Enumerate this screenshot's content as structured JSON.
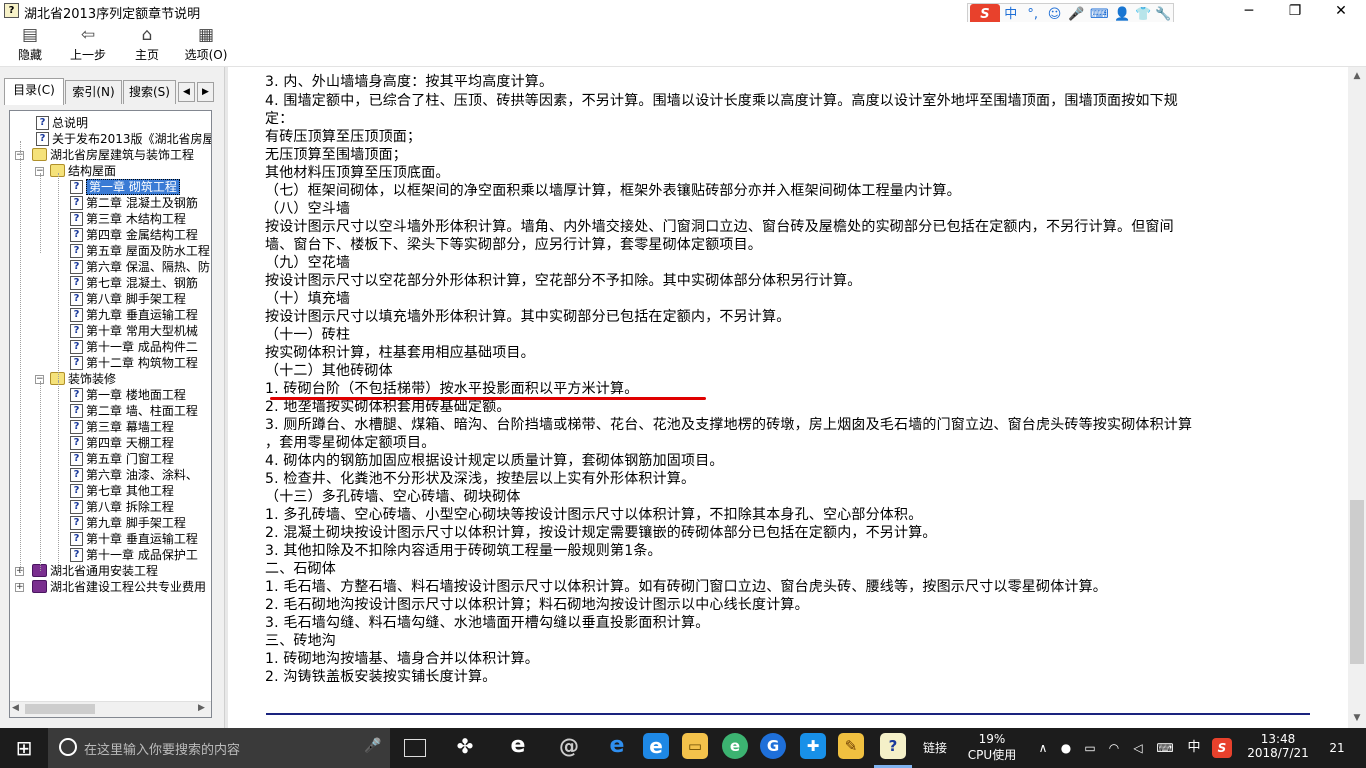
{
  "window": {
    "title": "湖北省2013序列定额章节说明",
    "app_icon_glyph": "?",
    "minimize": "─",
    "maximize": "❐",
    "close": "✕"
  },
  "ime": {
    "logo": "S",
    "mode": "中",
    "punct": "°,",
    "emoji": "☺",
    "voice": "🎤",
    "keyboard": "⌨",
    "user": "👤",
    "skin": "👕",
    "settings": "🔧"
  },
  "toolbar": {
    "hide": "隐藏",
    "back": "上一步",
    "home": "主页",
    "options": "选项(O)"
  },
  "tabs": {
    "contents": "目录(C)",
    "index": "索引(N)",
    "search": "搜索(S)",
    "prev": "◀",
    "next": "▶"
  },
  "tree": [
    {
      "label": "总说明",
      "icon": "help-page"
    },
    {
      "label": "关于发布2013版《湖北省房屋",
      "icon": "help-page"
    },
    {
      "label": "湖北省房屋建筑与装饰工程",
      "icon": "book-open"
    },
    {
      "label": "结构屋面",
      "icon": "book-open"
    },
    {
      "label": "第一章  砌筑工程",
      "icon": "help-page",
      "selected": true
    },
    {
      "label": "第二章  混凝土及钢筋",
      "icon": "help-page"
    },
    {
      "label": "第三章  木结构工程",
      "icon": "help-page"
    },
    {
      "label": "第四章  金属结构工程",
      "icon": "help-page"
    },
    {
      "label": "第五章  屋面及防水工程",
      "icon": "help-page"
    },
    {
      "label": "第六章  保温、隔热、防",
      "icon": "help-page"
    },
    {
      "label": "第七章  混凝土、钢筋",
      "icon": "help-page"
    },
    {
      "label": "第八章  脚手架工程",
      "icon": "help-page"
    },
    {
      "label": "第九章  垂直运输工程",
      "icon": "help-page"
    },
    {
      "label": "第十章  常用大型机械",
      "icon": "help-page"
    },
    {
      "label": "第十一章  成品构件二",
      "icon": "help-page"
    },
    {
      "label": "第十二章  构筑物工程",
      "icon": "help-page"
    },
    {
      "label": "装饰装修",
      "icon": "book-open"
    },
    {
      "label": "第一章  楼地面工程",
      "icon": "help-page"
    },
    {
      "label": "第二章  墙、柱面工程",
      "icon": "help-page"
    },
    {
      "label": "第三章  幕墙工程",
      "icon": "help-page"
    },
    {
      "label": "第四章  天棚工程",
      "icon": "help-page"
    },
    {
      "label": "第五章  门窗工程",
      "icon": "help-page"
    },
    {
      "label": "第六章  油漆、涂料、",
      "icon": "help-page"
    },
    {
      "label": "第七章  其他工程",
      "icon": "help-page"
    },
    {
      "label": "第八章  拆除工程",
      "icon": "help-page"
    },
    {
      "label": "第九章  脚手架工程",
      "icon": "help-page"
    },
    {
      "label": "第十章  垂直运输工程",
      "icon": "help-page"
    },
    {
      "label": "第十一章  成品保护工",
      "icon": "help-page"
    },
    {
      "label": "湖北省通用安装工程",
      "icon": "book-closed"
    },
    {
      "label": "湖北省建设工程公共专业费用",
      "icon": "book-closed"
    }
  ],
  "content": {
    "lines": [
      "3. 内、外山墙墙身高度：按其平均高度计算。",
      "4. 围墙定额中，已综合了柱、压顶、砖拱等因素，不另计算。围墙以设计长度乘以高度计算。高度以设计室外地坪至围墙顶面，围墙顶面按如下规",
      "定：",
      "有砖压顶算至压顶顶面；",
      "无压顶算至围墙顶面；",
      "其他材料压顶算至压顶底面。",
      "（七）框架间砌体，以框架间的净空面积乘以墙厚计算，框架外表镶贴砖部分亦并入框架间砌体工程量内计算。",
      "（八）空斗墙",
      "按设计图示尺寸以空斗墙外形体积计算。墙角、内外墙交接处、门窗洞口立边、窗台砖及屋檐处的实砌部分已包括在定额内，不另行计算。但窗间",
      "墙、窗台下、楼板下、梁头下等实砌部分，应另行计算，套零星砌体定额项目。",
      "（九）空花墙",
      "按设计图示尺寸以空花部分外形体积计算，空花部分不予扣除。其中实砌体部分体积另行计算。",
      "（十）填充墙",
      "按设计图示尺寸以填充墙外形体积计算。其中实砌部分已包括在定额内，不另计算。",
      "（十一）砖柱",
      "按实砌体积计算，柱基套用相应基础项目。",
      "（十二）其他砖砌体",
      "1. 砖砌台阶（不包括梯带）按水平投影面积以平方米计算。",
      "2. 地垄墙按实砌体积套用砖基础定额。",
      "3. 厕所蹲台、水槽腿、煤箱、暗沟、台阶挡墙或梯带、花台、花池及支撑地楞的砖墩，房上烟囱及毛石墙的门窗立边、窗台虎头砖等按实砌体积计算",
      "，套用零星砌体定额项目。",
      "4. 砌体内的钢筋加固应根据设计规定以质量计算，套砌体钢筋加固项目。",
      "5. 检查井、化粪池不分形状及深浅，按垫层以上实有外形体积计算。",
      "（十三）多孔砖墙、空心砖墙、砌块砌体",
      "1. 多孔砖墙、空心砖墙、小型空心砌块等按设计图示尺寸以体积计算，不扣除其本身孔、空心部分体积。",
      "2. 混凝土砌块按设计图示尺寸以体积计算，按设计规定需要镶嵌的砖砌体部分已包括在定额内，不另计算。",
      "3. 其他扣除及不扣除内容适用于砖砌筑工程量一般规则第1条。",
      "二、石砌体",
      "1. 毛石墙、方整石墙、料石墙按设计图示尺寸以体积计算。如有砖砌门窗口立边、窗台虎头砖、腰线等，按图示尺寸以零星砌体计算。",
      "2. 毛石砌地沟按设计图示尺寸以体积计算；料石砌地沟按设计图示以中心线长度计算。",
      "3. 毛石墙勾缝、料石墙勾缝、水池墙面开槽勾缝以垂直投影面积计算。",
      "三、砖地沟",
      "1. 砖砌地沟按墙基、墙身合并以体积计算。",
      "2. 沟铸铁盖板安装按实铺长度计算。"
    ]
  },
  "taskbar": {
    "search_placeholder": "在这里输入你要搜索的内容",
    "link_label": "链接",
    "cpu_percent": "19%",
    "cpu_label": "CPU使用",
    "ime_mode": "中",
    "time": "13:48",
    "date": "2018/7/21",
    "notification_count": "21"
  }
}
